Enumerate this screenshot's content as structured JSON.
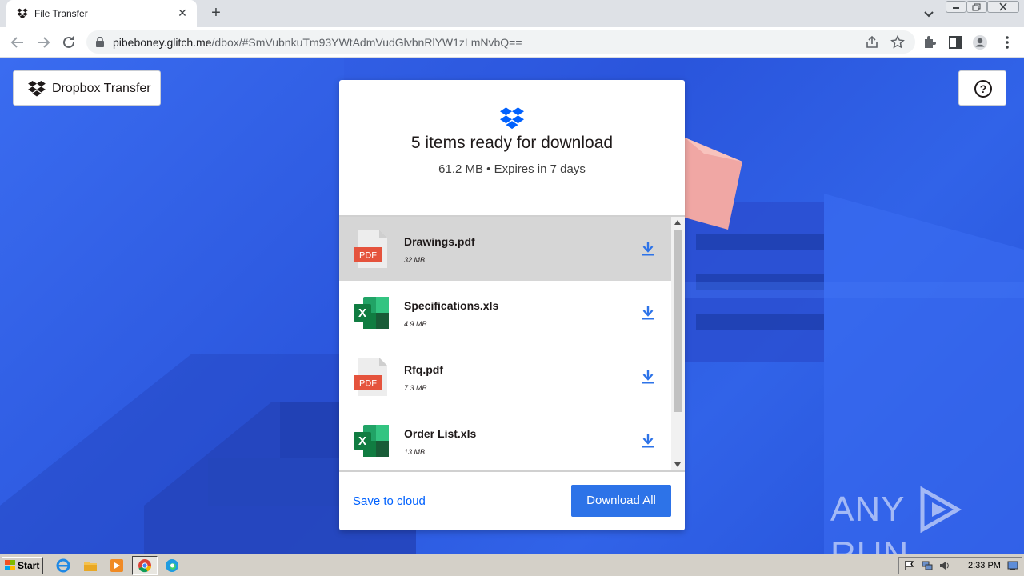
{
  "browser": {
    "tab_title": "File Transfer",
    "tab_close": "✕",
    "new_tab": "+",
    "url_host": "pibeboney.glitch.me",
    "url_path": "/dbox/#SmVubnkuTm93YWtAdmVudGlvbnRlYW1zLmNvbQ=="
  },
  "page": {
    "brand_label": "Dropbox Transfer",
    "help_symbol": "?",
    "heading": "5 items ready for download",
    "subheading": "61.2 MB • Expires in 7 days",
    "files": [
      {
        "name": "Drawings.pdf",
        "size": "32 MB",
        "type": "pdf",
        "icon_text": "PDF"
      },
      {
        "name": "Specifications.xls",
        "size": "4.9 MB",
        "type": "xls",
        "icon_text": "X"
      },
      {
        "name": "Rfq.pdf",
        "size": "7.3 MB",
        "type": "pdf",
        "icon_text": "PDF"
      },
      {
        "name": "Order List.xls",
        "size": "13 MB",
        "type": "xls",
        "icon_text": "X"
      }
    ],
    "save_to_cloud": "Save to cloud",
    "download_all": "Download All",
    "accent_color": "#2d73e8"
  },
  "watermark": {
    "left": "ANY",
    "right": "RUN"
  },
  "taskbar": {
    "start_label": "Start",
    "clock": "2:33 PM"
  }
}
